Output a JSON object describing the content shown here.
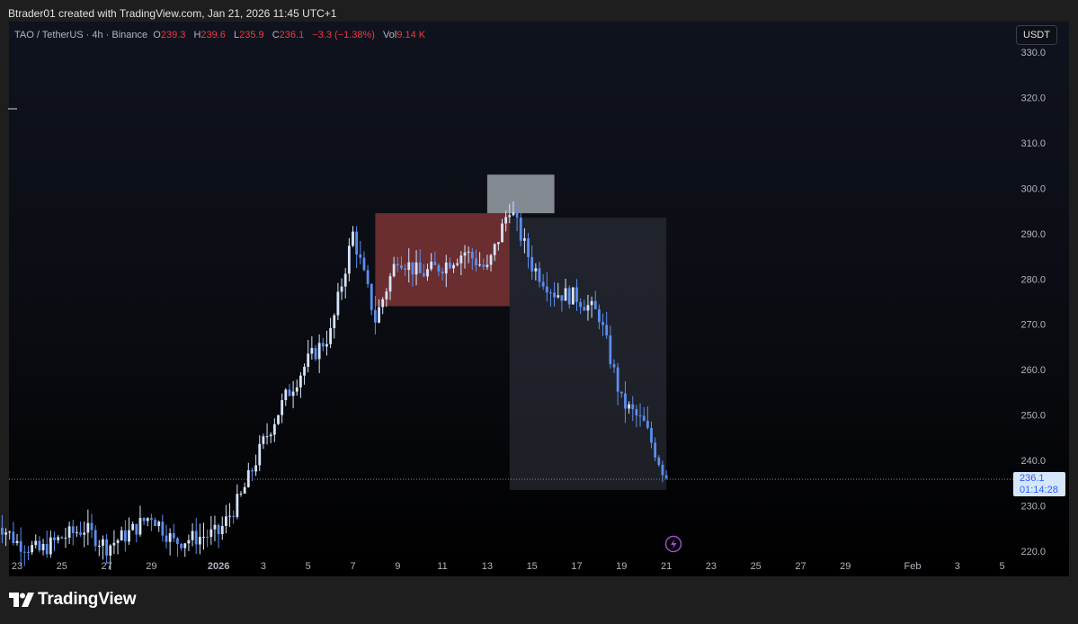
{
  "caption": "Btrader01 created with TradingView.com, Jan 21, 2026 11:45 UTC+1",
  "brand": "TradingView",
  "legend": {
    "symbol": "TAO / TetherUS · 4h · Binance",
    "o_label": "O",
    "o_value": "239.3",
    "h_label": "H",
    "h_value": "239.6",
    "l_label": "L",
    "l_value": "235.9",
    "c_label": "C",
    "c_value": "236.1",
    "change": "−3.3 (−1.38%)",
    "vol_label": "Vol",
    "vol_value": "9.14 K"
  },
  "currency_badge": "USDT",
  "last_price": {
    "value": "236.1",
    "countdown": "01:14:28"
  },
  "colors": {
    "candle": "#5b8def",
    "candle_light": "#d6e4fb",
    "down_text": "#f23645",
    "red_zone": "#8b3a3a",
    "grey_zone": "#9aa0a8",
    "tall_zone": "#2e323c"
  },
  "chart_data": {
    "type": "candlestick",
    "title": "TAO / TetherUS · 4h · Binance",
    "y_ticks": [
      "330.0",
      "320.0",
      "310.0",
      "300.0",
      "290.0",
      "280.0",
      "270.0",
      "260.0",
      "250.0",
      "240.0",
      "230.0",
      "220.0"
    ],
    "ylim": [
      219,
      332
    ],
    "x_ticks": [
      "23",
      "25",
      "27",
      "29",
      "2026",
      "3",
      "5",
      "7",
      "9",
      "11",
      "13",
      "15",
      "17",
      "19",
      "21",
      "23",
      "25",
      "27",
      "29",
      "Feb",
      "3",
      "5"
    ],
    "x_tick_dates": [
      "2025-12-23",
      "2025-12-25",
      "2025-12-27",
      "2025-12-29",
      "2026-01-01",
      "2026-01-03",
      "2026-01-05",
      "2026-01-07",
      "2026-01-09",
      "2026-01-11",
      "2026-01-13",
      "2026-01-15",
      "2026-01-17",
      "2026-01-19",
      "2026-01-21",
      "2026-01-23",
      "2026-01-25",
      "2026-01-27",
      "2026-01-29",
      "2026-02-01",
      "2026-02-03",
      "2026-02-05"
    ],
    "close_path": [
      [
        "2025-12-22",
        227
      ],
      [
        "2025-12-23",
        222
      ],
      [
        "2025-12-24",
        220
      ],
      [
        "2025-12-25",
        223
      ],
      [
        "2025-12-26",
        225
      ],
      [
        "2025-12-27",
        221
      ],
      [
        "2025-12-28",
        224
      ],
      [
        "2025-12-29",
        228
      ],
      [
        "2025-12-30",
        222
      ],
      [
        "2025-12-31",
        223
      ],
      [
        "2026-01-01",
        224
      ],
      [
        "2026-01-02",
        232
      ],
      [
        "2026-01-03",
        244
      ],
      [
        "2026-01-04",
        254
      ],
      [
        "2026-01-05",
        262
      ],
      [
        "2026-01-06",
        268
      ],
      [
        "2026-01-07",
        290
      ],
      [
        "2026-01-08",
        271
      ],
      [
        "2026-01-09",
        285
      ],
      [
        "2026-01-10",
        281
      ],
      [
        "2026-01-11",
        283
      ],
      [
        "2026-01-12",
        286
      ],
      [
        "2026-01-13",
        282
      ],
      [
        "2026-01-14",
        296
      ],
      [
        "2026-01-15",
        283
      ],
      [
        "2026-01-16",
        277
      ],
      [
        "2026-01-17",
        276
      ],
      [
        "2026-01-18",
        272
      ],
      [
        "2026-01-19",
        253
      ],
      [
        "2026-01-20",
        248
      ],
      [
        "2026-01-21",
        236.1
      ]
    ],
    "last_price": 236.1,
    "zones": [
      {
        "kind": "red-box",
        "from": "2026-01-08",
        "to": "2026-01-14",
        "y_low": 274,
        "y_high": 294.5
      },
      {
        "kind": "grey-box",
        "from": "2026-01-13",
        "to": "2026-01-16",
        "y_low": 294.5,
        "y_high": 303
      },
      {
        "kind": "tall-box",
        "from": "2026-01-14",
        "to": "2026-01-21",
        "y_low": 233.5,
        "y_high": 293.5
      }
    ],
    "grid": false
  }
}
